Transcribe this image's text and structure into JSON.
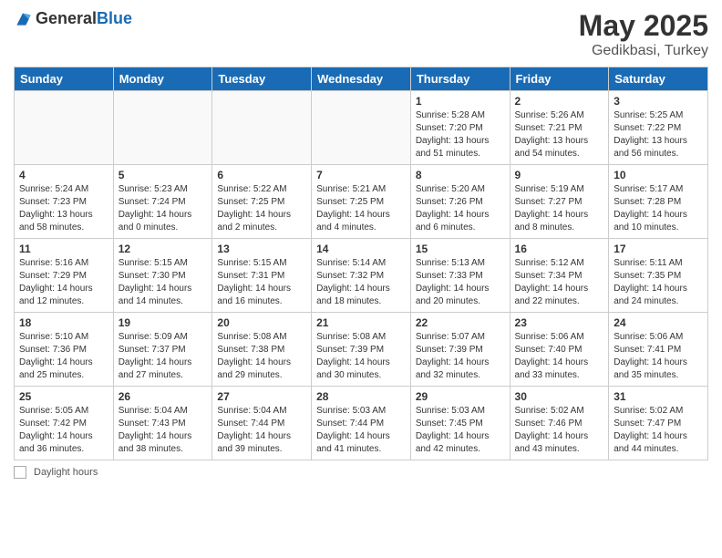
{
  "header": {
    "logo_general": "General",
    "logo_blue": "Blue",
    "month": "May 2025",
    "location": "Gedikbasi, Turkey"
  },
  "weekdays": [
    "Sunday",
    "Monday",
    "Tuesday",
    "Wednesday",
    "Thursday",
    "Friday",
    "Saturday"
  ],
  "note": "Daylight hours",
  "weeks": [
    [
      {
        "day": "",
        "info": ""
      },
      {
        "day": "",
        "info": ""
      },
      {
        "day": "",
        "info": ""
      },
      {
        "day": "",
        "info": ""
      },
      {
        "day": "1",
        "info": "Sunrise: 5:28 AM\nSunset: 7:20 PM\nDaylight: 13 hours\nand 51 minutes."
      },
      {
        "day": "2",
        "info": "Sunrise: 5:26 AM\nSunset: 7:21 PM\nDaylight: 13 hours\nand 54 minutes."
      },
      {
        "day": "3",
        "info": "Sunrise: 5:25 AM\nSunset: 7:22 PM\nDaylight: 13 hours\nand 56 minutes."
      }
    ],
    [
      {
        "day": "4",
        "info": "Sunrise: 5:24 AM\nSunset: 7:23 PM\nDaylight: 13 hours\nand 58 minutes."
      },
      {
        "day": "5",
        "info": "Sunrise: 5:23 AM\nSunset: 7:24 PM\nDaylight: 14 hours\nand 0 minutes."
      },
      {
        "day": "6",
        "info": "Sunrise: 5:22 AM\nSunset: 7:25 PM\nDaylight: 14 hours\nand 2 minutes."
      },
      {
        "day": "7",
        "info": "Sunrise: 5:21 AM\nSunset: 7:25 PM\nDaylight: 14 hours\nand 4 minutes."
      },
      {
        "day": "8",
        "info": "Sunrise: 5:20 AM\nSunset: 7:26 PM\nDaylight: 14 hours\nand 6 minutes."
      },
      {
        "day": "9",
        "info": "Sunrise: 5:19 AM\nSunset: 7:27 PM\nDaylight: 14 hours\nand 8 minutes."
      },
      {
        "day": "10",
        "info": "Sunrise: 5:17 AM\nSunset: 7:28 PM\nDaylight: 14 hours\nand 10 minutes."
      }
    ],
    [
      {
        "day": "11",
        "info": "Sunrise: 5:16 AM\nSunset: 7:29 PM\nDaylight: 14 hours\nand 12 minutes."
      },
      {
        "day": "12",
        "info": "Sunrise: 5:15 AM\nSunset: 7:30 PM\nDaylight: 14 hours\nand 14 minutes."
      },
      {
        "day": "13",
        "info": "Sunrise: 5:15 AM\nSunset: 7:31 PM\nDaylight: 14 hours\nand 16 minutes."
      },
      {
        "day": "14",
        "info": "Sunrise: 5:14 AM\nSunset: 7:32 PM\nDaylight: 14 hours\nand 18 minutes."
      },
      {
        "day": "15",
        "info": "Sunrise: 5:13 AM\nSunset: 7:33 PM\nDaylight: 14 hours\nand 20 minutes."
      },
      {
        "day": "16",
        "info": "Sunrise: 5:12 AM\nSunset: 7:34 PM\nDaylight: 14 hours\nand 22 minutes."
      },
      {
        "day": "17",
        "info": "Sunrise: 5:11 AM\nSunset: 7:35 PM\nDaylight: 14 hours\nand 24 minutes."
      }
    ],
    [
      {
        "day": "18",
        "info": "Sunrise: 5:10 AM\nSunset: 7:36 PM\nDaylight: 14 hours\nand 25 minutes."
      },
      {
        "day": "19",
        "info": "Sunrise: 5:09 AM\nSunset: 7:37 PM\nDaylight: 14 hours\nand 27 minutes."
      },
      {
        "day": "20",
        "info": "Sunrise: 5:08 AM\nSunset: 7:38 PM\nDaylight: 14 hours\nand 29 minutes."
      },
      {
        "day": "21",
        "info": "Sunrise: 5:08 AM\nSunset: 7:39 PM\nDaylight: 14 hours\nand 30 minutes."
      },
      {
        "day": "22",
        "info": "Sunrise: 5:07 AM\nSunset: 7:39 PM\nDaylight: 14 hours\nand 32 minutes."
      },
      {
        "day": "23",
        "info": "Sunrise: 5:06 AM\nSunset: 7:40 PM\nDaylight: 14 hours\nand 33 minutes."
      },
      {
        "day": "24",
        "info": "Sunrise: 5:06 AM\nSunset: 7:41 PM\nDaylight: 14 hours\nand 35 minutes."
      }
    ],
    [
      {
        "day": "25",
        "info": "Sunrise: 5:05 AM\nSunset: 7:42 PM\nDaylight: 14 hours\nand 36 minutes."
      },
      {
        "day": "26",
        "info": "Sunrise: 5:04 AM\nSunset: 7:43 PM\nDaylight: 14 hours\nand 38 minutes."
      },
      {
        "day": "27",
        "info": "Sunrise: 5:04 AM\nSunset: 7:44 PM\nDaylight: 14 hours\nand 39 minutes."
      },
      {
        "day": "28",
        "info": "Sunrise: 5:03 AM\nSunset: 7:44 PM\nDaylight: 14 hours\nand 41 minutes."
      },
      {
        "day": "29",
        "info": "Sunrise: 5:03 AM\nSunset: 7:45 PM\nDaylight: 14 hours\nand 42 minutes."
      },
      {
        "day": "30",
        "info": "Sunrise: 5:02 AM\nSunset: 7:46 PM\nDaylight: 14 hours\nand 43 minutes."
      },
      {
        "day": "31",
        "info": "Sunrise: 5:02 AM\nSunset: 7:47 PM\nDaylight: 14 hours\nand 44 minutes."
      }
    ]
  ]
}
